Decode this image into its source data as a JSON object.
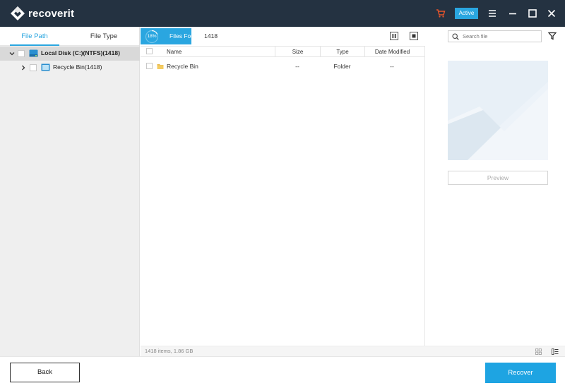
{
  "app": {
    "logo_text": "recoverit",
    "active_badge": "Active"
  },
  "left_panel": {
    "tabs": [
      {
        "label": "File Path",
        "selected": true
      },
      {
        "label": "File Type",
        "selected": false
      }
    ],
    "tree": [
      {
        "label": "Local Disk (C:)(NTFS)(1418)",
        "expanded": true,
        "selected": true
      },
      {
        "label": "Recycle Bin(1418)",
        "expanded": false,
        "selected": false
      }
    ]
  },
  "toolbar": {
    "progress": "18%",
    "progress_fraction": 0.18,
    "files_found_label": "Files Found:",
    "files_found_count": "1418",
    "search_placeholder": "Search file"
  },
  "table": {
    "columns": [
      "Name",
      "Size",
      "Type",
      "Date Modified"
    ],
    "rows": [
      {
        "name": "Recycle Bin",
        "size": "--",
        "type": "Folder",
        "date": "--"
      }
    ]
  },
  "preview": {
    "button_label": "Preview"
  },
  "status": {
    "summary": "1418 items, 1.86  GB"
  },
  "bottom": {
    "back_label": "Back",
    "recover_label": "Recover"
  },
  "colors": {
    "accent": "#1ea4e2",
    "titlebar": "#243241",
    "cart": "#e8552b"
  },
  "icons": [
    "recoverit-logo-icon",
    "cart-icon",
    "menu-icon",
    "minimize-icon",
    "maximize-icon",
    "close-icon",
    "chevron-down-icon",
    "chevron-right-icon",
    "drive-icon",
    "recycle-bin-folder-icon",
    "pause-icon",
    "stop-icon",
    "search-icon",
    "filter-icon",
    "folder-icon",
    "grid-view-icon",
    "list-view-icon"
  ]
}
